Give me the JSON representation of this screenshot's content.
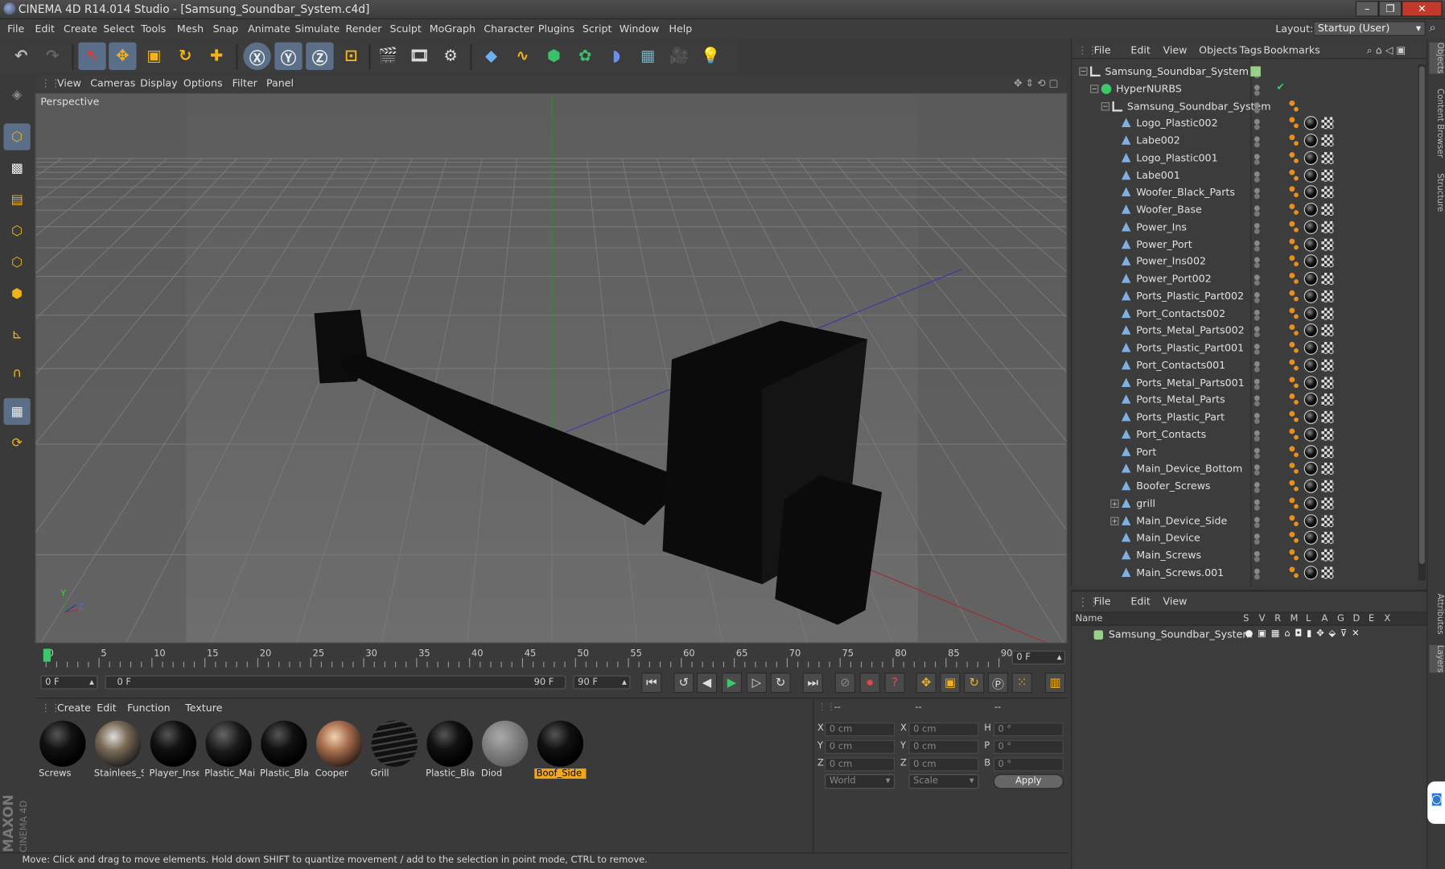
{
  "window": {
    "title": "CINEMA 4D R14.014 Studio - [Samsung_Soundbar_System.c4d]",
    "layout_label": "Layout:",
    "layout_value": "Startup (User)"
  },
  "menubar": [
    "File",
    "Edit",
    "Create",
    "Select",
    "Tools",
    "Mesh",
    "Snap",
    "Animate",
    "Simulate",
    "Render",
    "Sculpt",
    "MoGraph",
    "Character",
    "Plugins",
    "Script",
    "Window",
    "Help"
  ],
  "viewport": {
    "menu": [
      "View",
      "Cameras",
      "Display",
      "Options",
      "Filter",
      "Panel"
    ],
    "label": "Perspective",
    "axis_y": "Y",
    "axis_z": "Z"
  },
  "timeline": {
    "ticks": [
      "0",
      "5",
      "10",
      "15",
      "20",
      "25",
      "30",
      "35",
      "40",
      "45",
      "50",
      "55",
      "60",
      "65",
      "70",
      "75",
      "80",
      "85",
      "90"
    ],
    "current_frame": "0 F",
    "start": "0 F",
    "range_start": "0 F",
    "range_end": "90 F",
    "end": "90 F"
  },
  "materials": {
    "menu": [
      "Create",
      "Edit",
      "Function",
      "Texture"
    ],
    "items": [
      {
        "name": "Screws",
        "type": "black"
      },
      {
        "name": "Stainlees_S",
        "type": "chrome"
      },
      {
        "name": "Player_Inse",
        "type": "black"
      },
      {
        "name": "Plastic_Mai",
        "type": "dark"
      },
      {
        "name": "Plastic_Blac",
        "type": "black"
      },
      {
        "name": "Cooper",
        "type": "copper"
      },
      {
        "name": "Grill",
        "type": "grill"
      },
      {
        "name": "Plastic_Blac",
        "type": "black"
      },
      {
        "name": "Diod",
        "type": "grey"
      },
      {
        "name": "Boof_Side",
        "type": "black",
        "selected": true
      }
    ]
  },
  "coords": {
    "headers": [
      "--",
      "--",
      "--"
    ],
    "rows": [
      {
        "a": "X",
        "av": "0 cm",
        "b": "X",
        "bv": "0 cm",
        "c": "H",
        "cv": "0 °"
      },
      {
        "a": "Y",
        "av": "0 cm",
        "b": "Y",
        "bv": "0 cm",
        "c": "P",
        "cv": "0 °"
      },
      {
        "a": "Z",
        "av": "0 cm",
        "b": "Z",
        "bv": "0 cm",
        "c": "B",
        "cv": "0 °"
      }
    ],
    "mode1": "World",
    "mode2": "Scale",
    "apply": "Apply"
  },
  "status": "Move: Click and drag to move elements. Hold down SHIFT to quantize movement / add to the selection in point mode, CTRL to remove.",
  "objects": {
    "menu": [
      "File",
      "Edit",
      "View",
      "Objects",
      "Tags",
      "Bookmarks"
    ],
    "items": [
      {
        "name": "Samsung_Soundbar_System",
        "depth": 0,
        "kind": "null"
      },
      {
        "name": "HyperNURBS",
        "depth": 1,
        "kind": "nurbs"
      },
      {
        "name": "Samsung_Soundbar_System",
        "depth": 2,
        "kind": "null"
      },
      {
        "name": "Logo_Plastic002",
        "depth": 3,
        "kind": "poly"
      },
      {
        "name": "Labe002",
        "depth": 3,
        "kind": "poly"
      },
      {
        "name": "Logo_Plastic001",
        "depth": 3,
        "kind": "poly"
      },
      {
        "name": "Labe001",
        "depth": 3,
        "kind": "poly"
      },
      {
        "name": "Woofer_Black_Parts",
        "depth": 3,
        "kind": "poly"
      },
      {
        "name": "Woofer_Base",
        "depth": 3,
        "kind": "poly"
      },
      {
        "name": "Power_Ins",
        "depth": 3,
        "kind": "poly"
      },
      {
        "name": "Power_Port",
        "depth": 3,
        "kind": "poly"
      },
      {
        "name": "Power_Ins002",
        "depth": 3,
        "kind": "poly"
      },
      {
        "name": "Power_Port002",
        "depth": 3,
        "kind": "poly"
      },
      {
        "name": "Ports_Plastic_Part002",
        "depth": 3,
        "kind": "poly"
      },
      {
        "name": "Port_Contacts002",
        "depth": 3,
        "kind": "poly"
      },
      {
        "name": "Ports_Metal_Parts002",
        "depth": 3,
        "kind": "poly"
      },
      {
        "name": "Ports_Plastic_Part001",
        "depth": 3,
        "kind": "poly"
      },
      {
        "name": "Port_Contacts001",
        "depth": 3,
        "kind": "poly"
      },
      {
        "name": "Ports_Metal_Parts001",
        "depth": 3,
        "kind": "poly"
      },
      {
        "name": "Ports_Metal_Parts",
        "depth": 3,
        "kind": "poly"
      },
      {
        "name": "Ports_Plastic_Part",
        "depth": 3,
        "kind": "poly"
      },
      {
        "name": "Port_Contacts",
        "depth": 3,
        "kind": "poly"
      },
      {
        "name": "Port",
        "depth": 3,
        "kind": "poly"
      },
      {
        "name": "Main_Device_Bottom",
        "depth": 3,
        "kind": "poly"
      },
      {
        "name": "Boofer_Screws",
        "depth": 3,
        "kind": "poly"
      },
      {
        "name": "grill",
        "depth": 3,
        "kind": "poly",
        "expand": true
      },
      {
        "name": "Main_Device_Side",
        "depth": 3,
        "kind": "poly",
        "expand": true
      },
      {
        "name": "Main_Device",
        "depth": 3,
        "kind": "poly"
      },
      {
        "name": "Main_Screws",
        "depth": 3,
        "kind": "poly"
      },
      {
        "name": "Main_Screws.001",
        "depth": 3,
        "kind": "poly"
      }
    ]
  },
  "layers": {
    "menu": [
      "File",
      "Edit",
      "View"
    ],
    "columns": [
      "Name",
      "S",
      "V",
      "R",
      "M",
      "L",
      "A",
      "G",
      "D",
      "E",
      "X"
    ],
    "items": [
      {
        "name": "Samsung_Soundbar_System"
      }
    ]
  },
  "sidetabs": [
    "Objects",
    "Content Browser",
    "Structure",
    "Attributes",
    "Layers"
  ],
  "brand": {
    "maxon": "MAXON",
    "product": "CINEMA 4D"
  }
}
